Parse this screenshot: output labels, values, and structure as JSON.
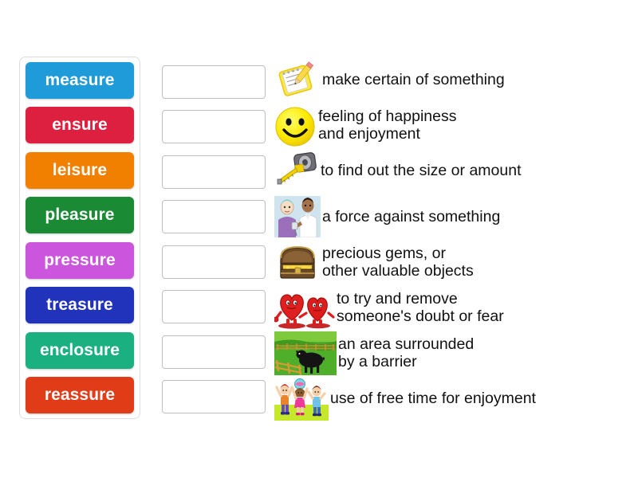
{
  "activity": {
    "type": "match-up",
    "columns": [
      "words",
      "answer-boxes",
      "definitions"
    ]
  },
  "words": {
    "items": [
      {
        "label": "measure",
        "color": "#1e9bd8"
      },
      {
        "label": "ensure",
        "color": "#dd2040"
      },
      {
        "label": "leisure",
        "color": "#f28000"
      },
      {
        "label": "pleasure",
        "color": "#1a8a35"
      },
      {
        "label": "pressure",
        "color": "#cc55dd"
      },
      {
        "label": "treasure",
        "color": "#2233bb"
      },
      {
        "label": "enclosure",
        "color": "#1ab080"
      },
      {
        "label": "reassure",
        "color": "#e03c18"
      }
    ]
  },
  "dropzones": {
    "count": 8,
    "values": [
      "",
      "",
      "",
      "",
      "",
      "",
      "",
      ""
    ],
    "placeholder": ""
  },
  "definitions": {
    "items": [
      {
        "icon": "notepad-pencil-icon",
        "text": "make certain of something"
      },
      {
        "icon": "smiley-face-icon",
        "text": "feeling of happiness\nand enjoyment"
      },
      {
        "icon": "tape-measure-icon",
        "text": "to find out the size or amount"
      },
      {
        "icon": "doctor-patient-icon",
        "text": "a force against something"
      },
      {
        "icon": "treasure-chest-icon",
        "text": "precious gems, or\nother valuable objects"
      },
      {
        "icon": "two-hearts-icon",
        "text": "to try and remove\nsomeone's doubt or fear"
      },
      {
        "icon": "sheep-enclosure-icon",
        "text": "an area surrounded\nby a barrier"
      },
      {
        "icon": "children-playing-icon",
        "text": "use of free time for enjoyment"
      }
    ]
  },
  "colors": {
    "page_background": "#ffffff",
    "panel_border": "#dcdcdc",
    "dropbox_border": "#bfbfbf",
    "text": "#111111",
    "tile_text": "#ffffff"
  }
}
